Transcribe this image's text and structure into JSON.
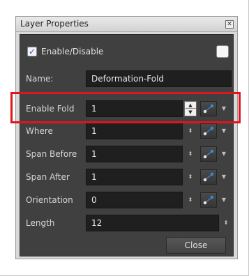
{
  "dialog": {
    "title": "Layer Properties",
    "close_icon": "close-x-icon",
    "enable": {
      "label": "Enable/Disable",
      "checked": true
    },
    "color_swatch": "#f7f7f7"
  },
  "fields": {
    "name": {
      "label": "Name:",
      "value": "Deformation-Fold"
    },
    "enable_fold": {
      "label": "Enable Fold",
      "value": "1"
    },
    "where": {
      "label": "Where",
      "value": "1"
    },
    "span_before": {
      "label": "Span Before",
      "value": "1"
    },
    "span_after": {
      "label": "Span After",
      "value": "1"
    },
    "orientation": {
      "label": "Orientation",
      "value": "0"
    },
    "length": {
      "label": "Length",
      "value": "12"
    }
  },
  "buttons": {
    "close_label": "Close"
  },
  "colors": {
    "highlight": "#e0141c",
    "panel": "#404040",
    "accent_blue": "#3a8ad8"
  }
}
